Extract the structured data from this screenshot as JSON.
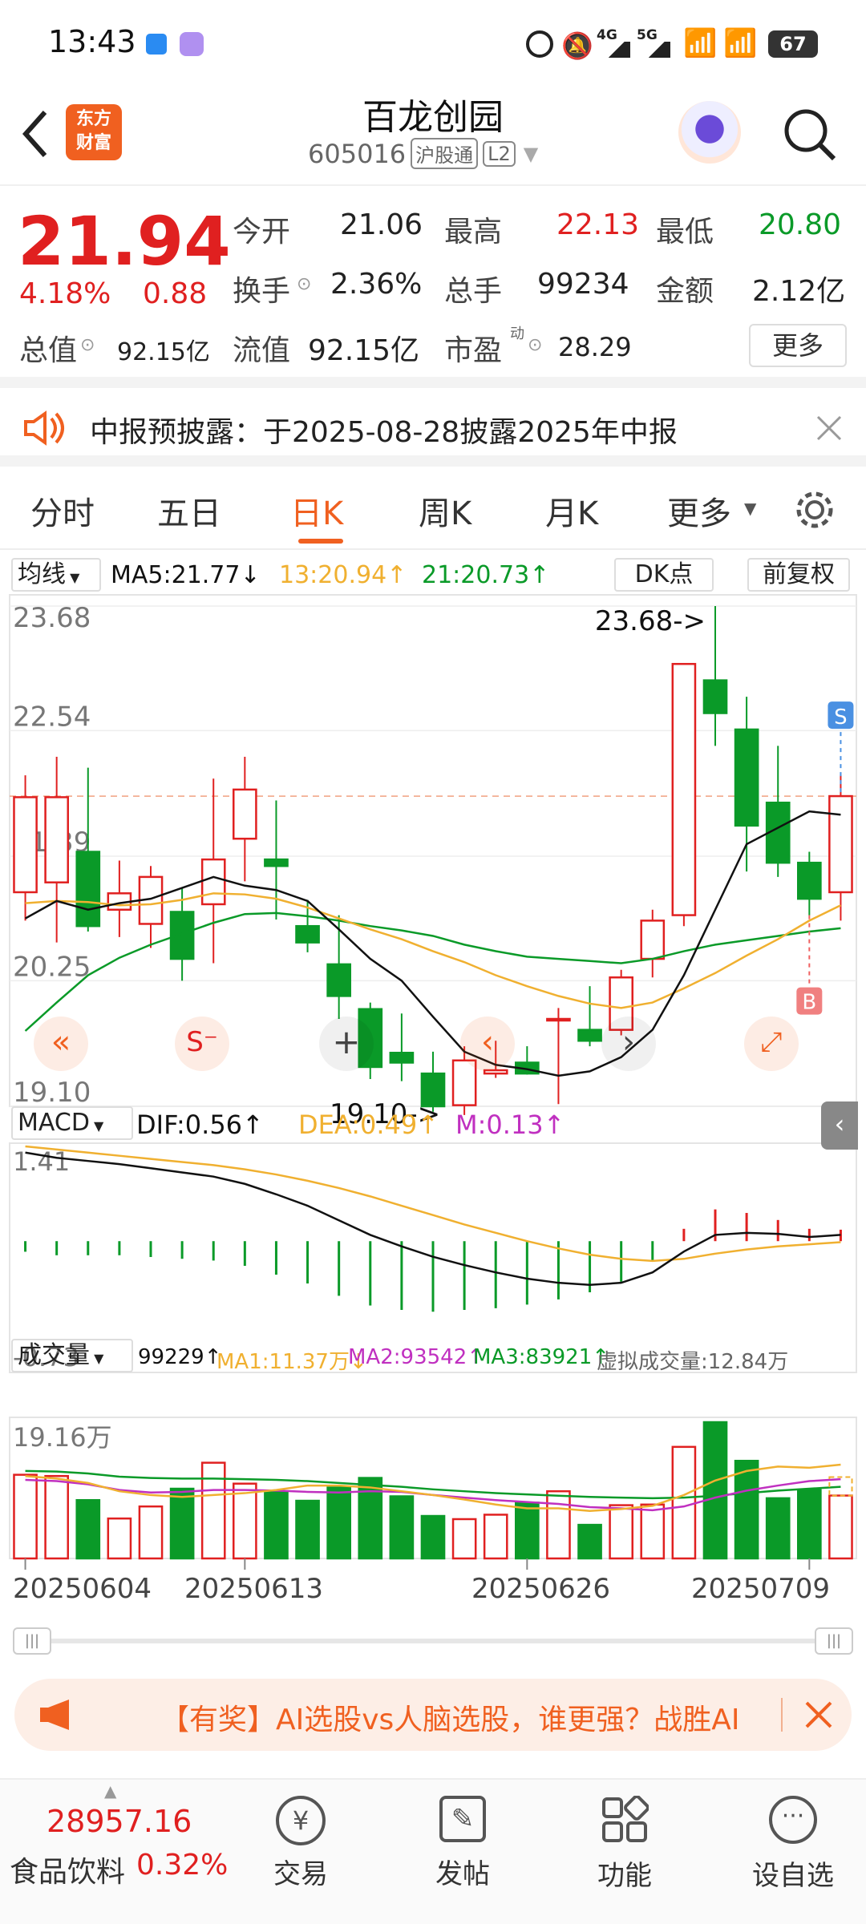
{
  "status_bar": {
    "time": "13:43",
    "battery": "67",
    "network": [
      "4G",
      "5G"
    ]
  },
  "header": {
    "back_icon": "chevron-left-icon",
    "logo_line1": "东方",
    "logo_line2": "财富",
    "stock_name": "百龙创园",
    "stock_code": "605016",
    "tag1": "沪股通",
    "tag2": "L2",
    "search_icon": "search-icon"
  },
  "quote": {
    "price": "21.94",
    "change_pct": "4.18%",
    "change_amt": "0.88",
    "open_label": "今开",
    "open": "21.06",
    "high_label": "最高",
    "high": "22.13",
    "low_label": "最低",
    "low": "20.80",
    "turnover_label": "换手",
    "turnover": "2.36%",
    "volume_label": "总手",
    "volume": "99234",
    "amount_label": "金额",
    "amount": "2.12亿",
    "mktcap_label": "总值",
    "mktcap": "92.15亿",
    "float_label": "流值",
    "float": "92.15亿",
    "pe_label": "市盈",
    "pe_sup": "动",
    "pe": "28.29",
    "more_label": "更多"
  },
  "notice": {
    "text": "中报预披露：于2025-08-28披露2025年中报"
  },
  "tabs": [
    "分时",
    "五日",
    "日K",
    "周K",
    "月K",
    "更多"
  ],
  "active_tab": "日K",
  "kline": {
    "ma_selector": "均线",
    "ma5": "MA5:21.77↓",
    "ma13": "13:20.94↑",
    "ma21": "21:20.73↑",
    "dk_label": "DK点",
    "adjust_label": "前复权",
    "y_ticks": [
      "23.68",
      "22.54",
      "21.39",
      "20.25",
      "19.10"
    ],
    "max_label": "23.68->",
    "min_label": "19.10->",
    "s_marker": "S",
    "b_marker": "B"
  },
  "macd": {
    "selector": "MACD",
    "dif": "DIF:0.56↑",
    "dea": "DEA:0.49↑",
    "m": "M:0.13↑",
    "y_top": "1.41",
    "y_bottom": "-0.73"
  },
  "volume": {
    "selector": "成交量",
    "vol": "99229↑",
    "ma1": "MA1:11.37万↓",
    "ma2": "MA2:93542↑",
    "ma3": "MA3:83921↑",
    "virtual": "虚拟成交量:12.84万",
    "y_top": "19.16万"
  },
  "dates": [
    "20250604",
    "20250613",
    "20250626",
    "20250709"
  ],
  "banner": {
    "text": "【有奖】AI选股vs人脑选股，谁更强？战胜AI"
  },
  "bottom": {
    "index_value": "28957.16",
    "index_name": "食品饮料",
    "index_pct": "0.32%",
    "nav": [
      "交易",
      "发帖",
      "功能",
      "设自选"
    ]
  },
  "colors": {
    "up": "#e02020",
    "down": "#0a9a28",
    "ma5": "#111111",
    "ma13": "#f0b030",
    "ma21": "#0a9a28",
    "accent": "#f06020"
  },
  "chart_data": {
    "type": "candlestick",
    "candles": [
      [
        21.06,
        21.93,
        22.13,
        20.8
      ],
      [
        21.15,
        21.93,
        22.3,
        20.6
      ],
      [
        21.43,
        20.75,
        22.2,
        20.7
      ],
      [
        20.9,
        21.05,
        21.35,
        20.65
      ],
      [
        20.77,
        21.2,
        21.3,
        20.55
      ],
      [
        20.88,
        20.45,
        21.1,
        20.25
      ],
      [
        20.95,
        21.36,
        22.1,
        20.41
      ],
      [
        21.55,
        22.0,
        22.3,
        21.16
      ],
      [
        21.36,
        21.3,
        21.9,
        20.81
      ],
      [
        20.75,
        20.6,
        20.99,
        20.51
      ],
      [
        20.4,
        20.11,
        20.85,
        19.9
      ],
      [
        19.99,
        19.46,
        20.05,
        19.35
      ],
      [
        19.59,
        19.5,
        19.95,
        19.33
      ],
      [
        19.4,
        19.1,
        19.6,
        19.05
      ],
      [
        19.11,
        19.52,
        19.65,
        19.02
      ],
      [
        19.4,
        19.43,
        19.7,
        19.36
      ],
      [
        19.5,
        19.4,
        19.65,
        19.39
      ],
      [
        19.9,
        19.9,
        20.0,
        19.12
      ],
      [
        19.8,
        19.7,
        20.2,
        19.65
      ],
      [
        19.8,
        20.28,
        20.35,
        19.75
      ],
      [
        20.45,
        20.8,
        20.9,
        20.28
      ],
      [
        20.85,
        23.15,
        23.15,
        20.75
      ],
      [
        23.0,
        22.7,
        23.68,
        22.4
      ],
      [
        22.55,
        21.67,
        22.85,
        21.25
      ],
      [
        21.88,
        21.33,
        22.4,
        21.2
      ],
      [
        21.33,
        21.0,
        21.43,
        20.85
      ],
      [
        21.06,
        21.94,
        22.13,
        20.8
      ]
    ],
    "ma5": [
      20.82,
      20.98,
      20.9,
      20.96,
      21.0,
      21.1,
      21.2,
      21.12,
      21.08,
      20.98,
      20.72,
      20.45,
      20.25,
      19.92,
      19.6,
      19.48,
      19.44,
      19.38,
      19.42,
      19.55,
      19.8,
      20.3,
      20.9,
      21.5,
      21.65,
      21.8,
      21.77
    ],
    "ma13": [
      20.96,
      20.98,
      20.97,
      20.94,
      20.95,
      20.99,
      21.05,
      21.04,
      21.0,
      20.92,
      20.82,
      20.72,
      20.63,
      20.52,
      20.42,
      20.3,
      20.2,
      20.11,
      20.04,
      20.0,
      20.05,
      20.18,
      20.32,
      20.48,
      20.63,
      20.8,
      20.94
    ],
    "ma21": [
      19.79,
      20.05,
      20.3,
      20.46,
      20.58,
      20.68,
      20.78,
      20.86,
      20.87,
      20.84,
      20.8,
      20.75,
      20.71,
      20.66,
      20.58,
      20.52,
      20.47,
      20.45,
      20.43,
      20.41,
      20.45,
      20.52,
      20.58,
      20.62,
      20.66,
      20.7,
      20.73
    ],
    "dif": [
      1.35,
      1.3,
      1.27,
      1.24,
      1.2,
      1.16,
      1.12,
      1.05,
      0.95,
      0.84,
      0.7,
      0.56,
      0.45,
      0.35,
      0.27,
      0.2,
      0.14,
      0.1,
      0.08,
      0.1,
      0.2,
      0.4,
      0.56,
      0.58,
      0.57,
      0.54,
      0.56
    ],
    "dea": [
      1.41,
      1.38,
      1.35,
      1.32,
      1.29,
      1.26,
      1.23,
      1.19,
      1.14,
      1.08,
      1.01,
      0.93,
      0.84,
      0.75,
      0.66,
      0.58,
      0.5,
      0.43,
      0.37,
      0.33,
      0.31,
      0.33,
      0.38,
      0.42,
      0.45,
      0.47,
      0.49
    ],
    "macd_hist": [
      -0.12,
      -0.16,
      -0.16,
      -0.16,
      -0.18,
      -0.2,
      -0.22,
      -0.28,
      -0.38,
      -0.48,
      -0.62,
      -0.73,
      -0.78,
      -0.8,
      -0.78,
      -0.76,
      -0.72,
      -0.66,
      -0.58,
      -0.46,
      -0.22,
      0.14,
      0.36,
      0.32,
      0.24,
      0.14,
      0.13
    ],
    "volumes": [
      13.2,
      13.0,
      9.2,
      6.3,
      8.2,
      11.0,
      15.1,
      11.8,
      10.6,
      9.1,
      11.2,
      12.7,
      9.8,
      6.7,
      6.2,
      6.9,
      8.8,
      10.6,
      5.3,
      8.4,
      8.5,
      17.6,
      21.5,
      15.4,
      9.5,
      10.8,
      9.92
    ],
    "vol_ma1": [
      13.0,
      12.6,
      11.9,
      10.6,
      10.0,
      9.7,
      10.0,
      10.3,
      10.8,
      11.5,
      11.5,
      11.2,
      10.6,
      10.0,
      9.3,
      8.5,
      7.9,
      7.9,
      7.5,
      7.8,
      8.3,
      10.0,
      12.3,
      13.8,
      14.5,
      14.3,
      14.8
    ],
    "vol_ma2": [
      12.4,
      12.2,
      11.7,
      10.8,
      10.4,
      10.5,
      10.8,
      10.8,
      10.7,
      10.5,
      10.4,
      10.6,
      10.5,
      10.0,
      9.6,
      9.2,
      8.9,
      8.6,
      8.1,
      7.9,
      7.6,
      8.2,
      9.6,
      10.7,
      11.5,
      12.2,
      12.5
    ],
    "vol_ma3": [
      13.8,
      13.7,
      13.4,
      12.9,
      12.7,
      12.6,
      12.6,
      12.5,
      12.4,
      12.2,
      11.9,
      11.6,
      11.3,
      10.9,
      10.6,
      10.3,
      10.1,
      9.9,
      9.7,
      9.6,
      9.5,
      9.6,
      9.9,
      10.3,
      10.7,
      11.0,
      11.3
    ],
    "ylim": [
      19.1,
      23.68
    ],
    "dates": [
      "20250604",
      "20250613",
      "20250626",
      "20250709"
    ]
  }
}
